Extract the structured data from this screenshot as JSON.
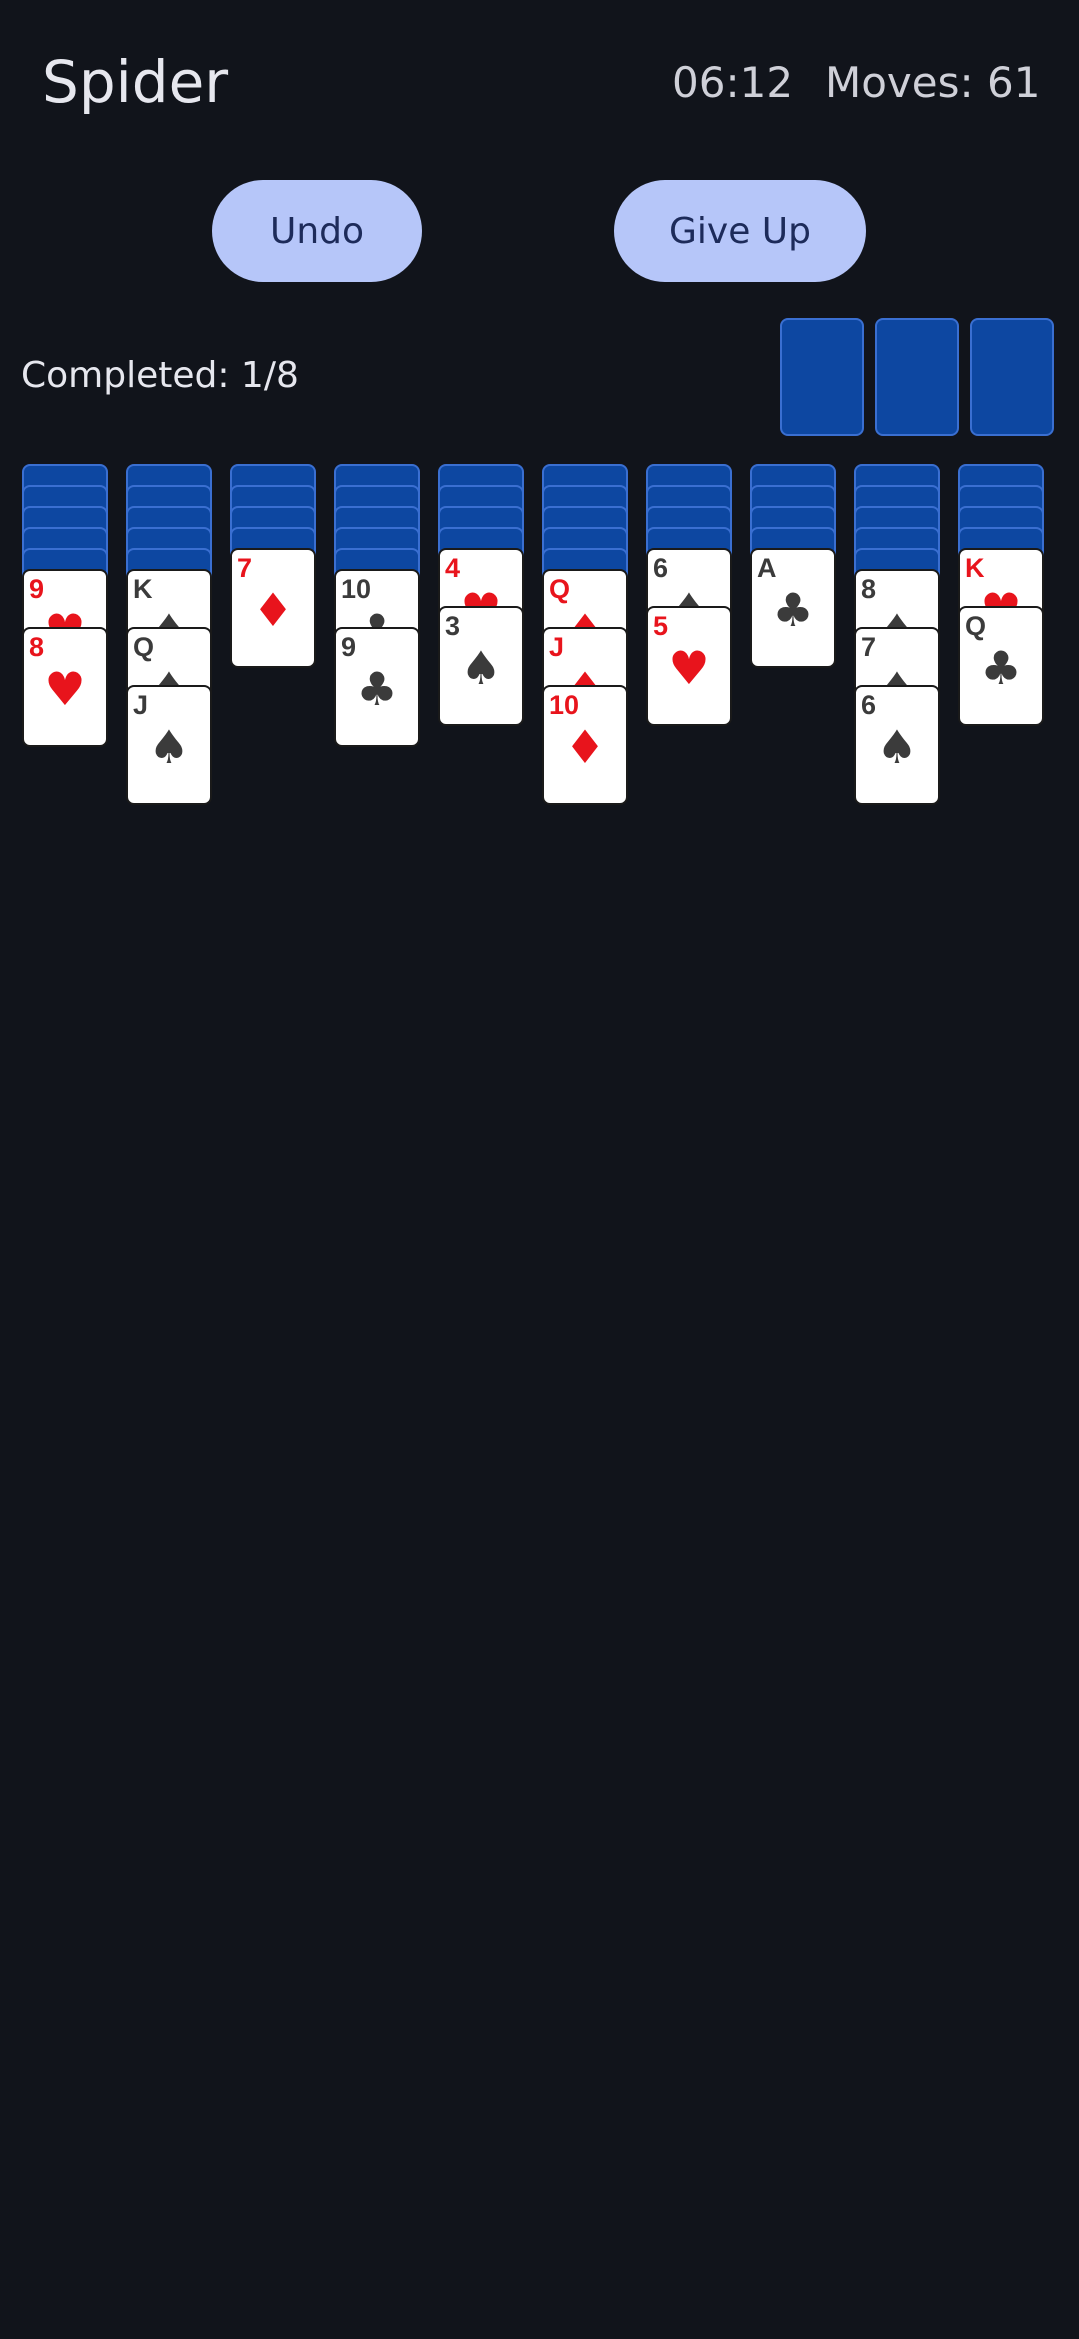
{
  "header": {
    "title": "Spider",
    "timer": "06:12",
    "moves": "Moves: 61"
  },
  "buttons": {
    "undo": "Undo",
    "give_up": "Give Up"
  },
  "completed": "Completed: 1/8",
  "stock_piles": 3,
  "suit_symbols": {
    "hearts": "♥",
    "diamonds": "♦",
    "spades": "♠",
    "clubs": "♣"
  },
  "colors": {
    "background": "#11141b",
    "button": "#b6c6f9",
    "card_back": "#0d47a1",
    "red": "#e8141c",
    "black": "#3b3b3b"
  },
  "tableau": [
    {
      "face_down": 5,
      "cards": [
        {
          "rank": "9",
          "suit": "hearts"
        },
        {
          "rank": "8",
          "suit": "hearts"
        }
      ]
    },
    {
      "face_down": 5,
      "cards": [
        {
          "rank": "K",
          "suit": "spades"
        },
        {
          "rank": "Q",
          "suit": "spades"
        },
        {
          "rank": "J",
          "suit": "spades"
        }
      ]
    },
    {
      "face_down": 4,
      "cards": [
        {
          "rank": "7",
          "suit": "diamonds"
        }
      ]
    },
    {
      "face_down": 5,
      "cards": [
        {
          "rank": "10",
          "suit": "clubs"
        },
        {
          "rank": "9",
          "suit": "clubs"
        }
      ]
    },
    {
      "face_down": 4,
      "cards": [
        {
          "rank": "4",
          "suit": "hearts"
        },
        {
          "rank": "3",
          "suit": "spades"
        }
      ]
    },
    {
      "face_down": 5,
      "cards": [
        {
          "rank": "Q",
          "suit": "diamonds"
        },
        {
          "rank": "J",
          "suit": "diamonds"
        },
        {
          "rank": "10",
          "suit": "diamonds"
        }
      ]
    },
    {
      "face_down": 4,
      "cards": [
        {
          "rank": "6",
          "suit": "spades"
        },
        {
          "rank": "5",
          "suit": "hearts"
        }
      ]
    },
    {
      "face_down": 4,
      "cards": [
        {
          "rank": "A",
          "suit": "clubs"
        }
      ]
    },
    {
      "face_down": 5,
      "cards": [
        {
          "rank": "8",
          "suit": "spades"
        },
        {
          "rank": "7",
          "suit": "spades"
        },
        {
          "rank": "6",
          "suit": "spades"
        }
      ]
    },
    {
      "face_down": 4,
      "cards": [
        {
          "rank": "K",
          "suit": "hearts"
        },
        {
          "rank": "Q",
          "suit": "clubs"
        }
      ]
    }
  ]
}
